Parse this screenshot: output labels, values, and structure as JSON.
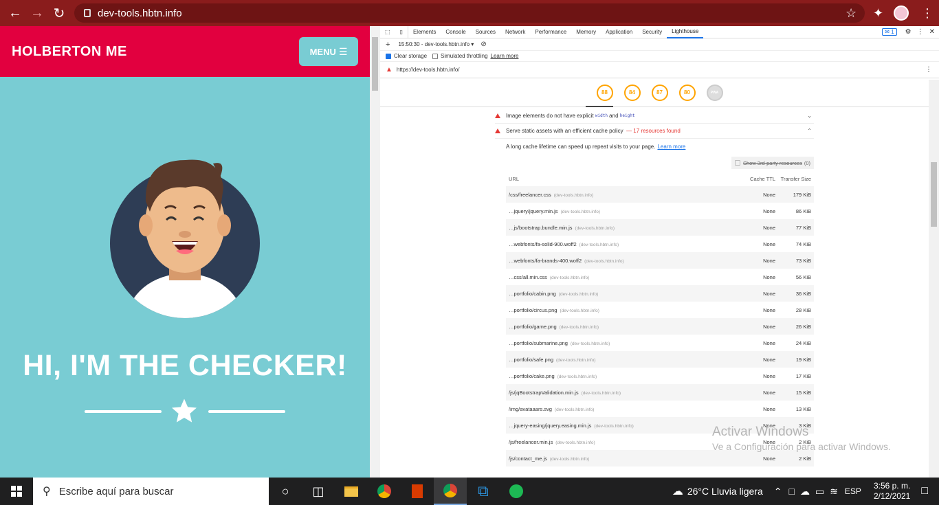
{
  "browser": {
    "url": "dev-tools.hbtn.info",
    "back_icon": "arrow-left-icon",
    "forward_icon": "arrow-right-icon",
    "reload_icon": "reload-icon"
  },
  "site": {
    "brand": "HOLBERTON ME",
    "menu_label": "MENU",
    "hero_title": "HI, I'M THE CHECKER!"
  },
  "devtools": {
    "tabs": [
      "Elements",
      "Console",
      "Sources",
      "Network",
      "Performance",
      "Memory",
      "Application",
      "Security",
      "Lighthouse"
    ],
    "active_tab": "Lighthouse",
    "issues_count": "1",
    "report_label": "15:50:30 - dev-tools.hbtn.info",
    "clear_storage": "Clear storage",
    "simulated_throttling": "Simulated throttling",
    "learn_more": "Learn more",
    "page_url": "https://dev-tools.hbtn.info/",
    "scores": [
      "88",
      "84",
      "87",
      "80"
    ],
    "pwa_label": "PWA",
    "audit1_text": "Image elements do not have explicit",
    "audit1_code1": "width",
    "audit1_and": "and",
    "audit1_code2": "height",
    "audit2_text": "Serve static assets with an efficient cache policy",
    "audit2_sep": "— 17 resources found",
    "description": "A long cache lifetime can speed up repeat visits to your page.",
    "description_link": "Learn more",
    "third_party_label": "Show 3rd-party resources",
    "third_party_count": "(0)",
    "table_headers": {
      "url": "URL",
      "ttl": "Cache TTL",
      "size": "Transfer Size"
    },
    "rows": [
      {
        "url": "/css/freelancer.css",
        "host": "(dev-tools.hbtn.info)",
        "ttl": "None",
        "size": "179 KiB"
      },
      {
        "url": "…jquery/jquery.min.js",
        "host": "(dev-tools.hbtn.info)",
        "ttl": "None",
        "size": "86 KiB"
      },
      {
        "url": "…js/bootstrap.bundle.min.js",
        "host": "(dev-tools.hbtn.info)",
        "ttl": "None",
        "size": "77 KiB"
      },
      {
        "url": "…webfonts/fa-solid-900.woff2",
        "host": "(dev-tools.hbtn.info)",
        "ttl": "None",
        "size": "74 KiB"
      },
      {
        "url": "…webfonts/fa-brands-400.woff2",
        "host": "(dev-tools.hbtn.info)",
        "ttl": "None",
        "size": "73 KiB"
      },
      {
        "url": "…css/all.min.css",
        "host": "(dev-tools.hbtn.info)",
        "ttl": "None",
        "size": "56 KiB"
      },
      {
        "url": "…portfolio/cabin.png",
        "host": "(dev-tools.hbtn.info)",
        "ttl": "None",
        "size": "36 KiB"
      },
      {
        "url": "…portfolio/circus.png",
        "host": "(dev-tools.hbtn.info)",
        "ttl": "None",
        "size": "28 KiB"
      },
      {
        "url": "…portfolio/game.png",
        "host": "(dev-tools.hbtn.info)",
        "ttl": "None",
        "size": "26 KiB"
      },
      {
        "url": "…portfolio/submarine.png",
        "host": "(dev-tools.hbtn.info)",
        "ttl": "None",
        "size": "24 KiB"
      },
      {
        "url": "…portfolio/safe.png",
        "host": "(dev-tools.hbtn.info)",
        "ttl": "None",
        "size": "19 KiB"
      },
      {
        "url": "…portfolio/cake.png",
        "host": "(dev-tools.hbtn.info)",
        "ttl": "None",
        "size": "17 KiB"
      },
      {
        "url": "/js/jqBootstrapValidation.min.js",
        "host": "(dev-tools.hbtn.info)",
        "ttl": "None",
        "size": "15 KiB"
      },
      {
        "url": "/img/avataaars.svg",
        "host": "(dev-tools.hbtn.info)",
        "ttl": "None",
        "size": "13 KiB"
      },
      {
        "url": "…jquery-easing/jquery.easing.min.js",
        "host": "(dev-tools.hbtn.info)",
        "ttl": "None",
        "size": "3 KiB"
      },
      {
        "url": "/js/freelancer.min.js",
        "host": "(dev-tools.hbtn.info)",
        "ttl": "None",
        "size": "2 KiB"
      },
      {
        "url": "/js/contact_me.js",
        "host": "(dev-tools.hbtn.info)",
        "ttl": "None",
        "size": "2 KiB"
      }
    ]
  },
  "watermark": {
    "line1": "Activar Windows",
    "line2": "Ve a Configuración para activar Windows."
  },
  "taskbar": {
    "search_placeholder": "Escribe aquí para buscar",
    "weather": "26°C  Lluvia ligera",
    "lang": "ESP",
    "time": "3:56 p. m.",
    "date": "2/12/2021"
  },
  "colors": {
    "browser_bar": "#8a1c1c",
    "site_nav": "#e2003f",
    "site_bg": "#79ccd3",
    "score_orange": "#ffa400",
    "fail_red": "#e53935"
  }
}
